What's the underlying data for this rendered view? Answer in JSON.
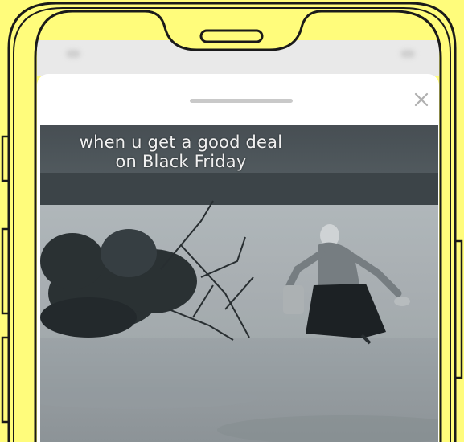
{
  "colors": {
    "background": "#FFFC7B",
    "phone_outline": "#1a1a1a",
    "sheet": "#ffffff",
    "status_bar": "#e9e9e9"
  },
  "sheet": {
    "grabber_icon": "drag-handle",
    "close_icon": "close-x"
  },
  "gif": {
    "caption": "when u get a good deal on Black Friday"
  }
}
